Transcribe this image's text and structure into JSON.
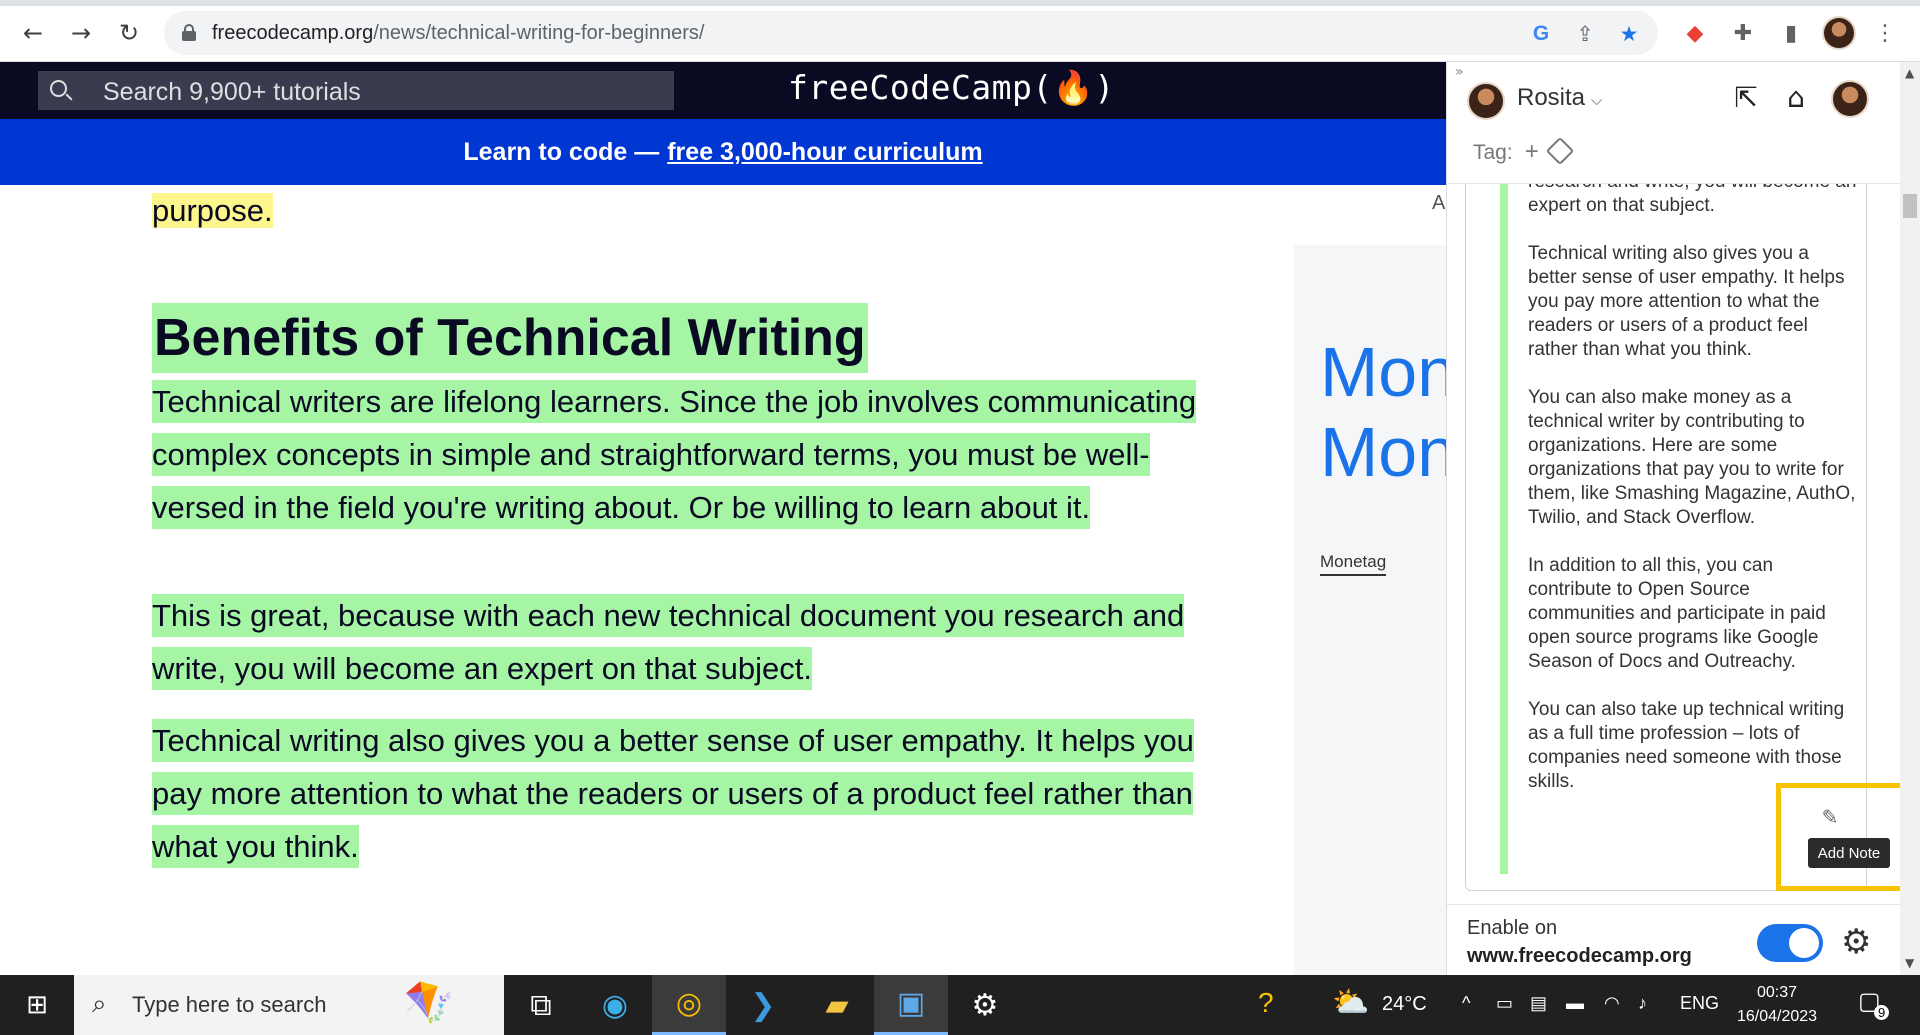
{
  "browser": {
    "url_domain": "freecodecamp.org",
    "url_path": "/news/technical-writing-for-beginners/"
  },
  "fcc": {
    "search_placeholder": "Search 9,900+ tutorials",
    "logo": "freeCodeCamp(🔥)",
    "banner_text": "Learn to code —",
    "banner_link": "free 3,000-hour curriculum"
  },
  "article": {
    "prev_fragment": "purpose.",
    "heading": "Benefits of Technical Writing",
    "paragraphs": [
      "Technical writers are lifelong learners. Since the job involves communicating complex concepts in simple and straightforward terms, you must be well-versed in the field you're writing about. Or be willing to learn about it.",
      "This is great, because with each new technical document you research and write, you will become an expert on that subject.",
      "Technical writing also gives you a better sense of user empathy. It helps you pay more attention to what the readers or users of a product feel rather than what you think."
    ]
  },
  "ad": {
    "letter": "A",
    "title": "Mon\nMon",
    "brand": "Monetag"
  },
  "panel": {
    "username": "Rosita",
    "tag_label": "Tag:",
    "note_paragraphs": [
      "research and write, you will become an expert on that subject.",
      "Technical writing also gives you a better sense of user empathy. It helps you pay more attention to what the readers or users of a product feel rather than what you think.",
      "You can also make money as a technical writer by contributing to organizations. Here are some organizations that pay you to write for them, like Smashing Magazine, AuthO, Twilio, and Stack Overflow.",
      "In addition to all this, you can contribute to Open Source communities and participate in paid open source programs like Google Season of Docs and Outreachy.",
      "You can also take up technical writing as a full time profession – lots of companies need someone with those skills."
    ],
    "tooltip": "Add Note",
    "enable_label": "Enable on",
    "enable_site": "www.freecodecamp.org",
    "enabled": true
  },
  "taskbar": {
    "search_placeholder": "Type here to search",
    "temperature": "24°C",
    "language": "ENG",
    "time": "00:37",
    "date": "16/04/2023",
    "notification_count": "9"
  }
}
